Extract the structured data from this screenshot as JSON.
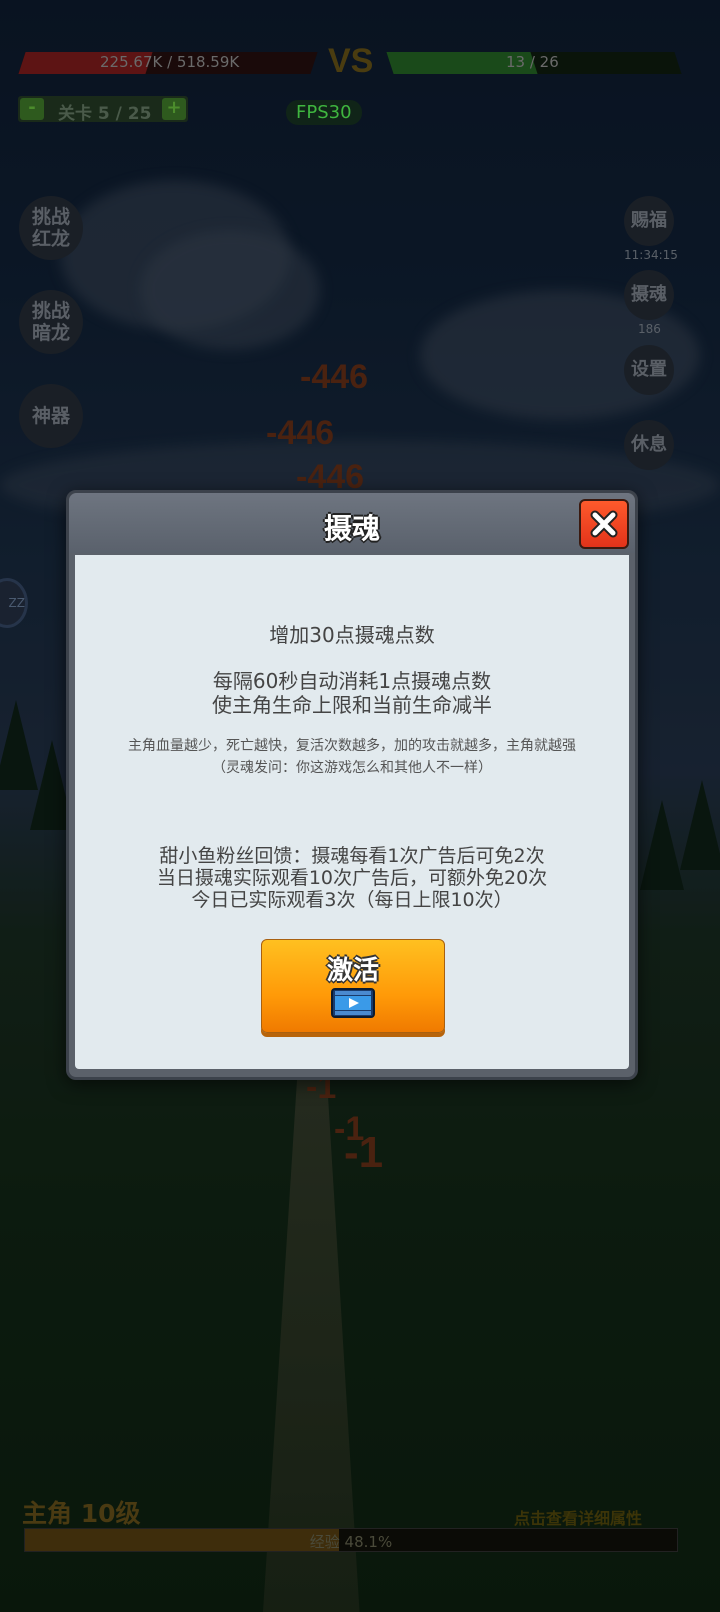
{
  "hud": {
    "enemy_hp": "225.67K / 518.59K",
    "enemy_hp_fraction": 0.435,
    "vs": "VS",
    "player_units": "13 / 26",
    "player_units_fraction": 0.5,
    "level_minus": "-",
    "level_label": "关卡 5 / 25",
    "level_plus": "+",
    "fps": "FPS30"
  },
  "left_buttons": [
    {
      "label": "挑战\n红龙"
    },
    {
      "label": "挑战\n暗龙"
    },
    {
      "label": "神器"
    }
  ],
  "right_buttons": {
    "blessing": "赐福",
    "blessing_timer": "11:34:15",
    "soul": "摄魂",
    "soul_count": "186",
    "settings": "设置",
    "rest": "休息"
  },
  "side_badge": "ZZ",
  "damage_numbers": [
    "-446",
    "-446",
    "-446",
    "-1",
    "-1",
    "-1"
  ],
  "modal": {
    "title": "摄魂",
    "close_icon": "close-x-icon",
    "line1": "增加30点摄魂点数",
    "line2": "每隔60秒自动消耗1点摄魂点数",
    "line3": "使主角生命上限和当前生命减半",
    "note1": "主角血量越少，死亡越快，复活次数越多，加的攻击就越多，主角就越强",
    "note2": "（灵魂发问：你这游戏怎么和其他人不一样）",
    "fan1": "甜小鱼粉丝回馈：摄魂每看1次广告后可免2次",
    "fan2": "当日摄魂实际观看10次广告后，可额外免20次",
    "fan3": "今日已实际观看3次（每日上限10次）",
    "activate_label": "激活",
    "activate_icon": "video-play-icon"
  },
  "bottom": {
    "hero_level": "主角 10级",
    "detail_link": "点击查看详细属性",
    "exp_label": "经验 48.1%",
    "exp_fraction": 0.481
  },
  "colors": {
    "accent_orange": "#ff9a08",
    "close_red": "#e2331a",
    "fps_green": "#3fb63f"
  }
}
